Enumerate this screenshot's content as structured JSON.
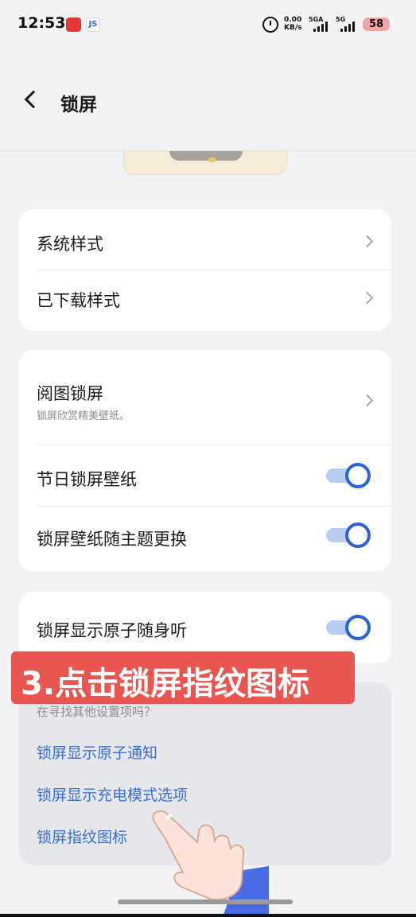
{
  "status_bar": {
    "time": "12:53",
    "app_icon_2": "JS",
    "net_speed_value": "0.00",
    "net_speed_unit": "KB/s",
    "signal_1_label": "5GA",
    "signal_2_label": "5G",
    "battery": "58"
  },
  "header": {
    "title": "锁屏"
  },
  "style_card": {
    "items": [
      {
        "label": "系统样式"
      },
      {
        "label": "已下载样式"
      }
    ]
  },
  "wallpaper_card": {
    "items": [
      {
        "label": "阅图锁屏",
        "subtitle": "锁屏欣赏精美壁纸。"
      },
      {
        "label": "节日锁屏壁纸",
        "toggle_on": true
      },
      {
        "label": "锁屏壁纸随主题更换",
        "toggle_on": true
      }
    ]
  },
  "atom_card": {
    "label": "锁屏显示原子随身听",
    "toggle_on": true
  },
  "more_card": {
    "hint": "在寻找其他设置项吗？",
    "links": [
      {
        "label": "锁屏显示原子通知"
      },
      {
        "label": "锁屏显示充电模式选项"
      },
      {
        "label": "锁屏指纹图标"
      }
    ]
  },
  "overlay": {
    "banner_text": "3.点击锁屏指纹图标"
  },
  "colors": {
    "accent": "#2b62d8",
    "link": "#3a6fd8",
    "banner": "#ea5550",
    "background": "#f2f3f5"
  }
}
